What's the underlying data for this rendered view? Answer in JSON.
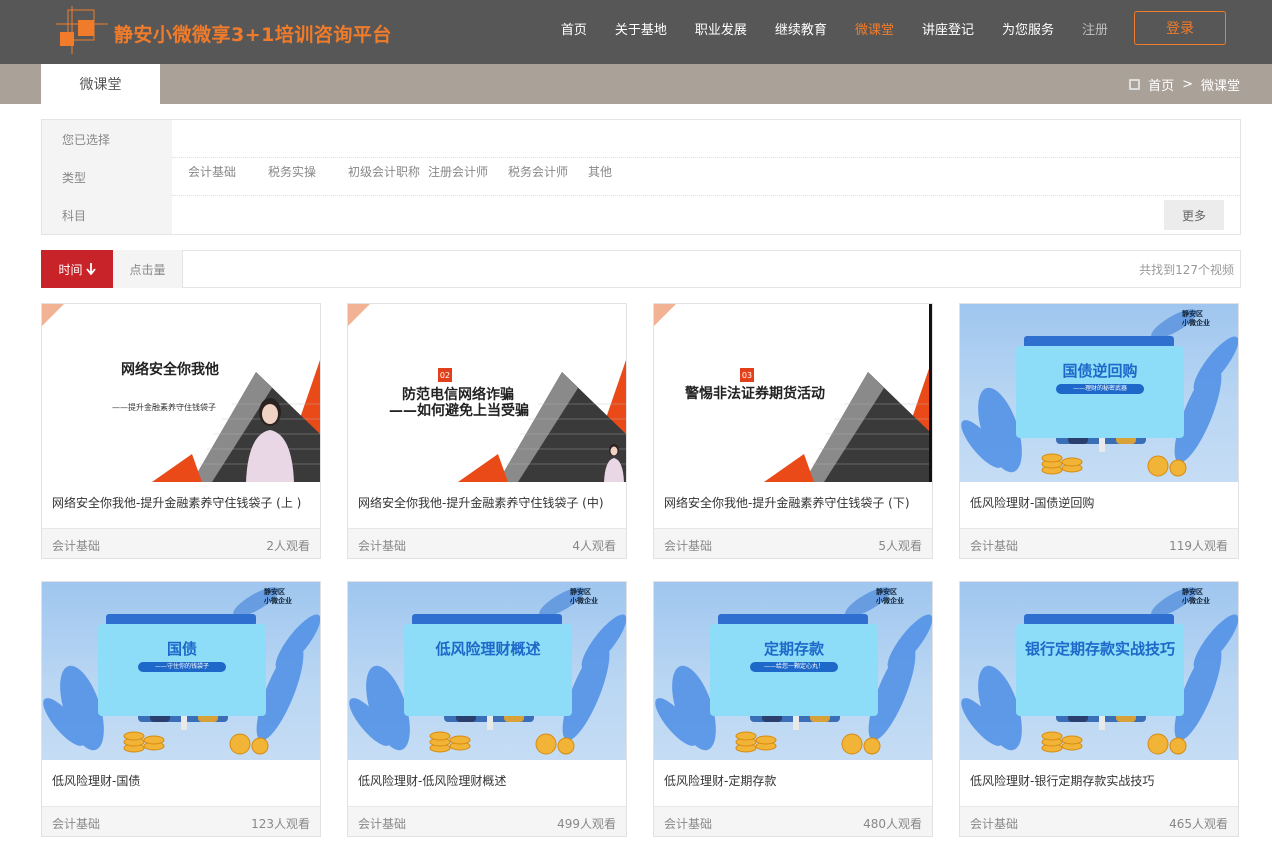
{
  "header": {
    "logo_text": "静安小微微享3+1培训咨询平台",
    "nav": [
      "首页",
      "关于基地",
      "职业发展",
      "继续教育",
      "微课堂",
      "讲座登记",
      "为您服务"
    ],
    "active_nav": "微课堂",
    "register_label": "注册",
    "login_label": "登录"
  },
  "subbar": {
    "tab_label": "微课堂",
    "breadcrumb": {
      "home": "首页",
      "separator": ">",
      "current": "微课堂"
    }
  },
  "filter": {
    "selected_label": "您已选择",
    "type_label": "类型",
    "type_options": [
      "会计基础",
      "税务实操",
      "初级会计职称",
      "注册会计师",
      "税务会计师",
      "其他"
    ],
    "subject_label": "科目",
    "more_label": "更多"
  },
  "sort": {
    "time_label": "时间",
    "clicks_label": "点击量",
    "result_text": "共找到127个视频"
  },
  "cards": [
    {
      "title": "网络安全你我他-提升金融素养守住钱袋子 (上 )",
      "category": "会计基础",
      "views": "2人观看",
      "thumb": {
        "kind": "slide",
        "num": "",
        "heading": "网络安全你我他",
        "sub": "——提升金融素养守住钱袋子"
      }
    },
    {
      "title": "网络安全你我他-提升金融素养守住钱袋子 (中)",
      "category": "会计基础",
      "views": "4人观看",
      "thumb": {
        "kind": "slide",
        "num": "02",
        "heading": "防范电信网络诈骗",
        "heading2": "——如何避免上当受骗"
      }
    },
    {
      "title": "网络安全你我他-提升金融素养守住钱袋子 (下)",
      "category": "会计基础",
      "views": "5人观看",
      "thumb": {
        "kind": "slide",
        "num": "03",
        "heading": "警惕非法证券期货活动"
      }
    },
    {
      "title": "低风险理财-国债逆回购",
      "category": "会计基础",
      "views": "119人观看",
      "thumb": {
        "kind": "fin",
        "heading": "国债逆回购",
        "sub": "——理财的秘密武器"
      }
    },
    {
      "title": "低风险理财-国债",
      "category": "会计基础",
      "views": "123人观看",
      "thumb": {
        "kind": "fin",
        "heading": "国债",
        "sub": "——守住你的钱袋子"
      }
    },
    {
      "title": "低风险理财-低风险理财概述",
      "category": "会计基础",
      "views": "499人观看",
      "thumb": {
        "kind": "fin",
        "heading": "低风险理财概述",
        "sub": ""
      }
    },
    {
      "title": "低风险理财-定期存款",
      "category": "会计基础",
      "views": "480人观看",
      "thumb": {
        "kind": "fin",
        "heading": "定期存款",
        "sub": "——给您一颗定心丸！"
      }
    },
    {
      "title": "低风险理财-银行定期存款实战技巧",
      "category": "会计基础",
      "views": "465人观看",
      "thumb": {
        "kind": "fin",
        "heading": "银行定期存款实战技巧",
        "sub": ""
      }
    }
  ],
  "fin_badge": {
    "line1": "静安区",
    "line2": "小微企业"
  },
  "colors": {
    "header_bg": "#575757",
    "accent": "#f07c2b",
    "sort_active": "#c9232a",
    "subbar_bg": "#aaa199"
  }
}
